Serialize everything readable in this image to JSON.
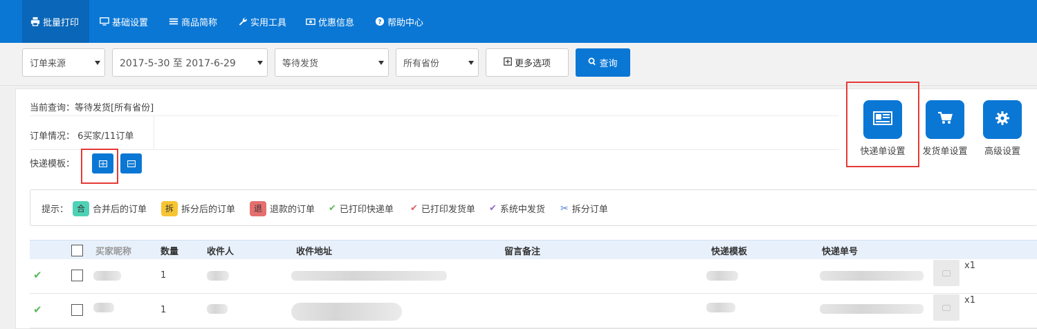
{
  "nav": {
    "items": [
      {
        "label": "批量打印",
        "icon": "printer-icon",
        "active": true
      },
      {
        "label": "基础设置",
        "icon": "monitor-icon",
        "active": false
      },
      {
        "label": "商品简称",
        "icon": "list-icon",
        "active": false
      },
      {
        "label": "实用工具",
        "icon": "wrench-icon",
        "active": false
      },
      {
        "label": "优惠信息",
        "icon": "money-icon",
        "active": false
      },
      {
        "label": "帮助中心",
        "icon": "help-circle-icon",
        "active": false
      }
    ]
  },
  "filters": {
    "order_source": "订单来源",
    "date_range": "2017-5-30 至 2017-6-29",
    "status": "等待发货",
    "province": "所有省份",
    "more_label": "更多选项",
    "query_label": "查询"
  },
  "info": {
    "current_query": "当前查询：等待发货[所有省份]",
    "order_status": "订单情况： 6买家/11订单",
    "template_label": "快递模板："
  },
  "actions": {
    "express_settings": "快递单设置",
    "shipping_settings": "发货单设置",
    "advanced_settings": "高级设置"
  },
  "legend": {
    "prefix": "提示：",
    "merged": {
      "badge": "合",
      "label": "合并后的订单",
      "color": "#4fd1b5"
    },
    "split": {
      "badge": "拆",
      "label": "拆分后的订单",
      "color": "#f7c533"
    },
    "refund": {
      "badge": "退",
      "label": "退款的订单",
      "color": "#e56f6f"
    },
    "printed_express": "已打印快递单",
    "printed_shipping": "已打印发货单",
    "system_shipped": "系统中发货",
    "split_order": "拆分订单"
  },
  "table": {
    "headers": {
      "buyer": "买家昵称",
      "qty": "数量",
      "recipient": "收件人",
      "address": "收件地址",
      "remark": "留言备注",
      "template": "快递模板",
      "tracking": "快递单号"
    },
    "rows": [
      {
        "qty": "1",
        "item_qty": "x1"
      },
      {
        "qty": "1",
        "item_qty": "x1"
      }
    ]
  },
  "colors": {
    "primary": "#0a77d5",
    "highlight": "#e53935",
    "check_green": "#5cb85c",
    "check_red": "#e06060",
    "check_purple": "#8e6bc9",
    "split_blue": "#4a7fd4"
  }
}
